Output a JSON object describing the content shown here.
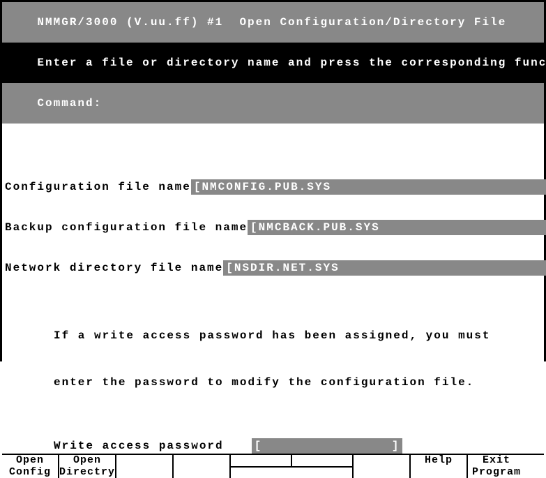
{
  "header": {
    "title": "NMMGR/3000 (V.uu.ff) #1  Open Configuration/Directory File"
  },
  "instruction": "Enter a file or directory name and press the corresponding function key.",
  "command_prompt": "Command:",
  "fields": {
    "config_label": "Configuration file name",
    "config_value": "[NMCONFIG.PUB.SYS                             ]",
    "backup_label": "Backup configuration file name",
    "backup_value": "[NMCBACK.PUB.SYS                              ]",
    "network_label": "Network directory file name",
    "network_value": "[NSDIR.NET.SYS                                ]"
  },
  "info": {
    "line1": "If a write access password has been assigned, you must",
    "line2": "enter the password to modify the configuration file."
  },
  "password": {
    "label": "Write access password",
    "value": "[                ]"
  },
  "fkeys": {
    "f1_line1": "Open",
    "f1_line2": "Config",
    "f2_line1": "Open",
    "f2_line2": "Directry",
    "f7": "Help",
    "f8_line1": "Exit",
    "f8_line2": "Program"
  }
}
